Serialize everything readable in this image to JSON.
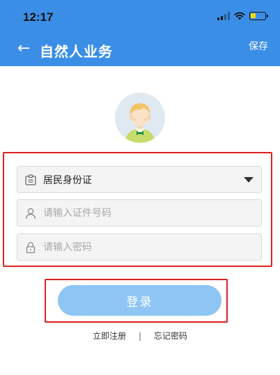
{
  "status_bar": {
    "time": "12:17"
  },
  "nav": {
    "back_icon": "left-arrow-icon",
    "title": "自然人业务",
    "save_label": "保存"
  },
  "avatar": {
    "icon": "user-avatar-icon"
  },
  "form": {
    "id_type": {
      "icon": "id-card-icon",
      "value": "居民身份证"
    },
    "id_number": {
      "icon": "user-icon",
      "placeholder": "请输入证件号码"
    },
    "password": {
      "icon": "lock-icon",
      "placeholder": "请输入密码"
    }
  },
  "login": {
    "label": "登录"
  },
  "links": {
    "register": "立即注册",
    "separator": "|",
    "forgot_password": "忘记密码"
  },
  "colors": {
    "header": "#3a8ee6",
    "login_button": "#8ec5f5",
    "highlight_frame": "#e02020"
  }
}
